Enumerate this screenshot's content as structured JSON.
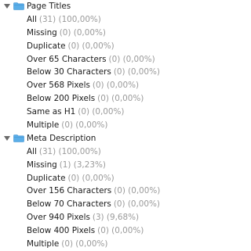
{
  "groups": [
    {
      "label": "Page Titles",
      "items": [
        {
          "label": "All",
          "count": "(31) (100,00%)"
        },
        {
          "label": "Missing",
          "count": "(0) (0,00%)"
        },
        {
          "label": "Duplicate",
          "count": "(0) (0,00%)"
        },
        {
          "label": "Over 65 Characters",
          "count": "(0) (0,00%)"
        },
        {
          "label": "Below 30 Characters",
          "count": "(0) (0,00%)"
        },
        {
          "label": "Over 568 Pixels",
          "count": "(0) (0,00%)"
        },
        {
          "label": "Below 200 Pixels",
          "count": "(0) (0,00%)"
        },
        {
          "label": "Same as H1",
          "count": "(0) (0,00%)"
        },
        {
          "label": "Multiple",
          "count": "(0) (0,00%)"
        }
      ]
    },
    {
      "label": "Meta Description",
      "items": [
        {
          "label": "All",
          "count": "(31) (100,00%)"
        },
        {
          "label": "Missing",
          "count": "(1) (3,23%)"
        },
        {
          "label": "Duplicate",
          "count": "(0) (0,00%)"
        },
        {
          "label": "Over 156 Characters",
          "count": "(0) (0,00%)"
        },
        {
          "label": "Below 70 Characters",
          "count": "(0) (0,00%)"
        },
        {
          "label": "Over 940 Pixels",
          "count": "(3) (9,68%)"
        },
        {
          "label": "Below 400 Pixels",
          "count": "(0) (0,00%)"
        },
        {
          "label": "Multiple",
          "count": "(0) (0,00%)"
        }
      ]
    }
  ],
  "colors": {
    "folder": "#5aaee8",
    "folder_dark": "#3d8fd1",
    "caret": "#6a6a6a",
    "label": "#1a1a1a",
    "count": "#9a9a9a"
  },
  "icons": {
    "expand": "caret-down-icon",
    "group": "folder-icon"
  }
}
